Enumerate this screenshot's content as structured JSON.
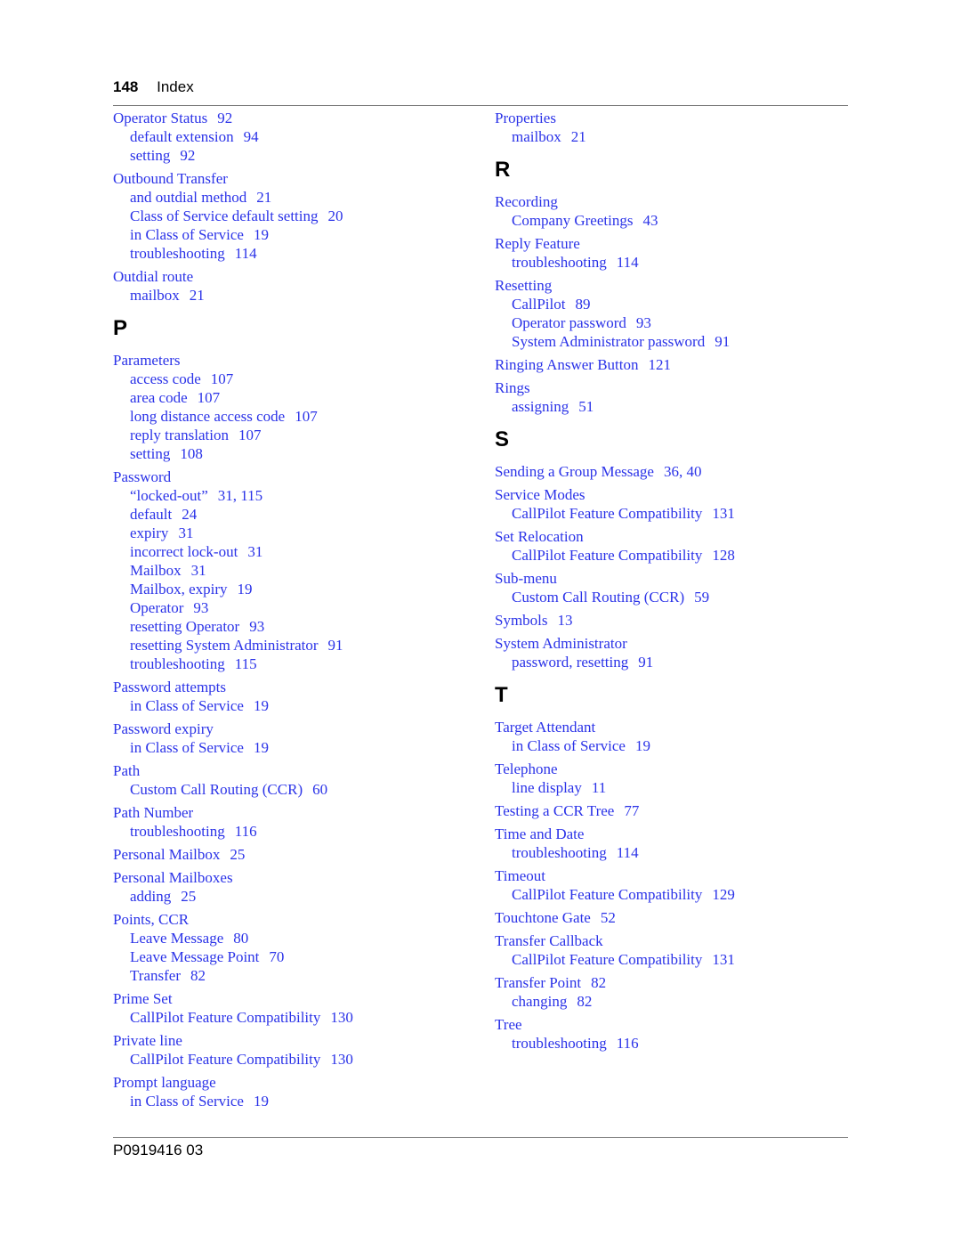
{
  "header": {
    "page_number": "148",
    "section": "Index"
  },
  "footer": {
    "doc_id": "P0919416 03"
  },
  "left_column": [
    {
      "type": "entry",
      "term": "Operator Status",
      "pages": "92",
      "subs": [
        {
          "term": "default extension",
          "pages": "94"
        },
        {
          "term": "setting",
          "pages": "92"
        }
      ]
    },
    {
      "type": "entry",
      "term": "Outbound Transfer",
      "pages": "",
      "subs": [
        {
          "term": "and outdial method",
          "pages": "21"
        },
        {
          "term": "Class of Service default setting",
          "pages": "20"
        },
        {
          "term": "in Class of Service",
          "pages": "19"
        },
        {
          "term": "troubleshooting",
          "pages": "114"
        }
      ]
    },
    {
      "type": "entry",
      "term": "Outdial route",
      "pages": "",
      "subs": [
        {
          "term": "mailbox",
          "pages": "21"
        }
      ]
    },
    {
      "type": "letter",
      "letter": "P"
    },
    {
      "type": "entry",
      "term": "Parameters",
      "pages": "",
      "subs": [
        {
          "term": "access code",
          "pages": "107"
        },
        {
          "term": "area code",
          "pages": "107"
        },
        {
          "term": "long distance access code",
          "pages": "107"
        },
        {
          "term": "reply translation",
          "pages": "107"
        },
        {
          "term": "setting",
          "pages": "108"
        }
      ]
    },
    {
      "type": "entry",
      "term": "Password",
      "pages": "",
      "subs": [
        {
          "term": "“locked-out”",
          "pages": "31, 115"
        },
        {
          "term": "default",
          "pages": "24"
        },
        {
          "term": "expiry",
          "pages": "31"
        },
        {
          "term": "incorrect lock-out",
          "pages": "31"
        },
        {
          "term": "Mailbox",
          "pages": "31"
        },
        {
          "term": "Mailbox, expiry",
          "pages": "19"
        },
        {
          "term": "Operator",
          "pages": "93"
        },
        {
          "term": "resetting Operator",
          "pages": "93"
        },
        {
          "term": "resetting System Administrator",
          "pages": "91"
        },
        {
          "term": "troubleshooting",
          "pages": "115"
        }
      ]
    },
    {
      "type": "entry",
      "term": "Password attempts",
      "pages": "",
      "subs": [
        {
          "term": "in Class of Service",
          "pages": "19"
        }
      ]
    },
    {
      "type": "entry",
      "term": "Password expiry",
      "pages": "",
      "subs": [
        {
          "term": "in Class of Service",
          "pages": "19"
        }
      ]
    },
    {
      "type": "entry",
      "term": "Path",
      "pages": "",
      "subs": [
        {
          "term": "Custom Call Routing (CCR)",
          "pages": "60"
        }
      ]
    },
    {
      "type": "entry",
      "term": "Path Number",
      "pages": "",
      "subs": [
        {
          "term": "troubleshooting",
          "pages": "116"
        }
      ]
    },
    {
      "type": "entry",
      "term": "Personal Mailbox",
      "pages": "25",
      "subs": []
    },
    {
      "type": "entry",
      "term": "Personal Mailboxes",
      "pages": "",
      "subs": [
        {
          "term": "adding",
          "pages": "25"
        }
      ]
    },
    {
      "type": "entry",
      "term": "Points, CCR",
      "pages": "",
      "subs": [
        {
          "term": "Leave Message",
          "pages": "80"
        },
        {
          "term": "Leave Message Point",
          "pages": "70"
        },
        {
          "term": "Transfer",
          "pages": "82"
        }
      ]
    },
    {
      "type": "entry",
      "term": "Prime Set",
      "pages": "",
      "subs": [
        {
          "term": "CallPilot Feature Compatibility",
          "pages": "130"
        }
      ]
    },
    {
      "type": "entry",
      "term": "Private line",
      "pages": "",
      "subs": [
        {
          "term": "CallPilot Feature Compatibility",
          "pages": "130"
        }
      ]
    },
    {
      "type": "entry",
      "term": "Prompt language",
      "pages": "",
      "subs": [
        {
          "term": "in Class of Service",
          "pages": "19"
        }
      ]
    }
  ],
  "right_column": [
    {
      "type": "entry",
      "term": "Properties",
      "pages": "",
      "subs": [
        {
          "term": "mailbox",
          "pages": "21"
        }
      ]
    },
    {
      "type": "letter",
      "letter": "R"
    },
    {
      "type": "entry",
      "term": "Recording",
      "pages": "",
      "subs": [
        {
          "term": "Company Greetings",
          "pages": "43"
        }
      ]
    },
    {
      "type": "entry",
      "term": "Reply Feature",
      "pages": "",
      "subs": [
        {
          "term": "troubleshooting",
          "pages": "114"
        }
      ]
    },
    {
      "type": "entry",
      "term": "Resetting",
      "pages": "",
      "subs": [
        {
          "term": "CallPilot",
          "pages": "89"
        },
        {
          "term": "Operator password",
          "pages": "93"
        },
        {
          "term": "System Administrator password",
          "pages": "91"
        }
      ]
    },
    {
      "type": "entry",
      "term": "Ringing Answer Button",
      "pages": "121",
      "subs": []
    },
    {
      "type": "entry",
      "term": "Rings",
      "pages": "",
      "subs": [
        {
          "term": "assigning",
          "pages": "51"
        }
      ]
    },
    {
      "type": "letter",
      "letter": "S"
    },
    {
      "type": "entry",
      "term": "Sending a Group Message",
      "pages": "36, 40",
      "subs": []
    },
    {
      "type": "entry",
      "term": "Service Modes",
      "pages": "",
      "subs": [
        {
          "term": "CallPilot Feature Compatibility",
          "pages": "131"
        }
      ]
    },
    {
      "type": "entry",
      "term": "Set Relocation",
      "pages": "",
      "subs": [
        {
          "term": "CallPilot Feature Compatibility",
          "pages": "128"
        }
      ]
    },
    {
      "type": "entry",
      "term": "Sub-menu",
      "pages": "",
      "subs": [
        {
          "term": "Custom Call Routing (CCR)",
          "pages": "59"
        }
      ]
    },
    {
      "type": "entry",
      "term": "Symbols",
      "pages": "13",
      "subs": []
    },
    {
      "type": "entry",
      "term": "System Administrator",
      "pages": "",
      "subs": [
        {
          "term": "password, resetting",
          "pages": "91"
        }
      ]
    },
    {
      "type": "letter",
      "letter": "T"
    },
    {
      "type": "entry",
      "term": "Target Attendant",
      "pages": "",
      "subs": [
        {
          "term": "in Class of Service",
          "pages": "19"
        }
      ]
    },
    {
      "type": "entry",
      "term": "Telephone",
      "pages": "",
      "subs": [
        {
          "term": "line display",
          "pages": "11"
        }
      ]
    },
    {
      "type": "entry",
      "term": "Testing a CCR Tree",
      "pages": "77",
      "subs": []
    },
    {
      "type": "entry",
      "term": "Time and Date",
      "pages": "",
      "subs": [
        {
          "term": "troubleshooting",
          "pages": "114"
        }
      ]
    },
    {
      "type": "entry",
      "term": "Timeout",
      "pages": "",
      "subs": [
        {
          "term": "CallPilot Feature Compatibility",
          "pages": "129"
        }
      ]
    },
    {
      "type": "entry",
      "term": "Touchtone Gate",
      "pages": "52",
      "subs": []
    },
    {
      "type": "entry",
      "term": "Transfer Callback",
      "pages": "",
      "subs": [
        {
          "term": "CallPilot Feature Compatibility",
          "pages": "131"
        }
      ]
    },
    {
      "type": "entry",
      "term": "Transfer Point",
      "pages": "82",
      "subs": [
        {
          "term": "changing",
          "pages": "82"
        }
      ]
    },
    {
      "type": "entry",
      "term": "Tree",
      "pages": "",
      "subs": [
        {
          "term": "troubleshooting",
          "pages": "116"
        }
      ]
    }
  ]
}
